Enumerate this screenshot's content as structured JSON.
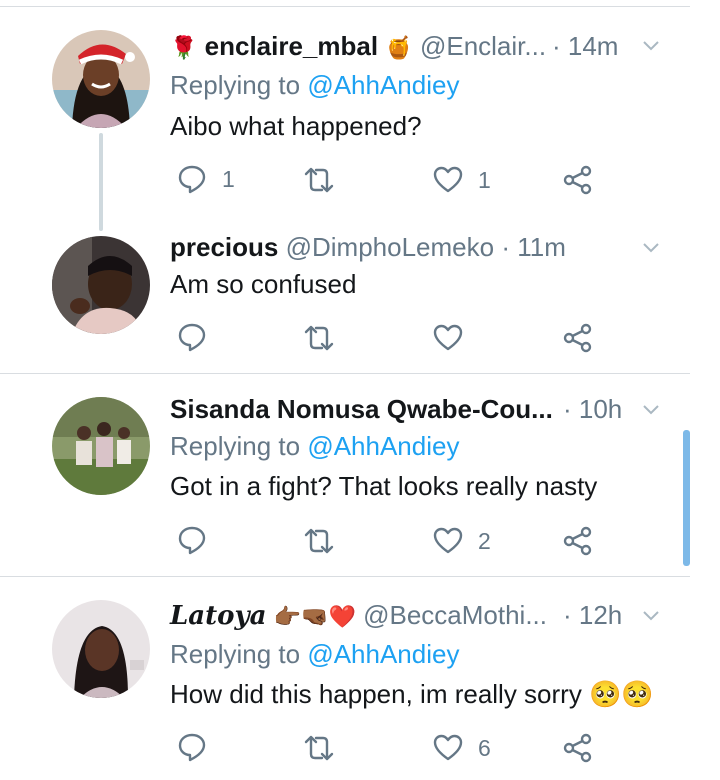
{
  "tweets": [
    {
      "name": "enclaire_mbal",
      "handle": "@Enclair...",
      "time": "· 14m",
      "replying_prefix": "Replying to",
      "replying_to": "@AhhAndiey",
      "text": "Aibo what happened?",
      "replies": "1",
      "retweets": "",
      "likes": "1",
      "name_prefix_emoji": "🌹",
      "name_suffix_emoji": "🍯"
    },
    {
      "name": "precious",
      "handle": "@DimphoLemeko",
      "time": "· 11m",
      "text": "Am so confused",
      "replies": "",
      "retweets": "",
      "likes": ""
    },
    {
      "name": "Sisanda Nomusa Qwabe-Cou...",
      "handle": "",
      "time": "· 10h",
      "replying_prefix": "Replying to",
      "replying_to": "@AhhAndiey",
      "text": "Got in a fight? That looks really nasty",
      "replies": "",
      "retweets": "",
      "likes": "2"
    },
    {
      "name": "Latoya",
      "name_emojis": "👉🏾🤜🏾❤️",
      "handle": "@BeccaMothi...",
      "time": "· 12h",
      "replying_prefix": "Replying to",
      "replying_to": "@AhhAndiey",
      "text": "How did this happen, im really sorry 🥺🥺",
      "replies": "",
      "retweets": "",
      "likes": "6"
    }
  ],
  "colors": {
    "accent": "#1da1f2",
    "secondary_text": "#657786",
    "primary_text": "#14171a",
    "divider": "#d9dde1"
  },
  "icons": [
    "reply-icon",
    "retweet-icon",
    "like-icon",
    "share-icon",
    "chevron-down-icon"
  ]
}
